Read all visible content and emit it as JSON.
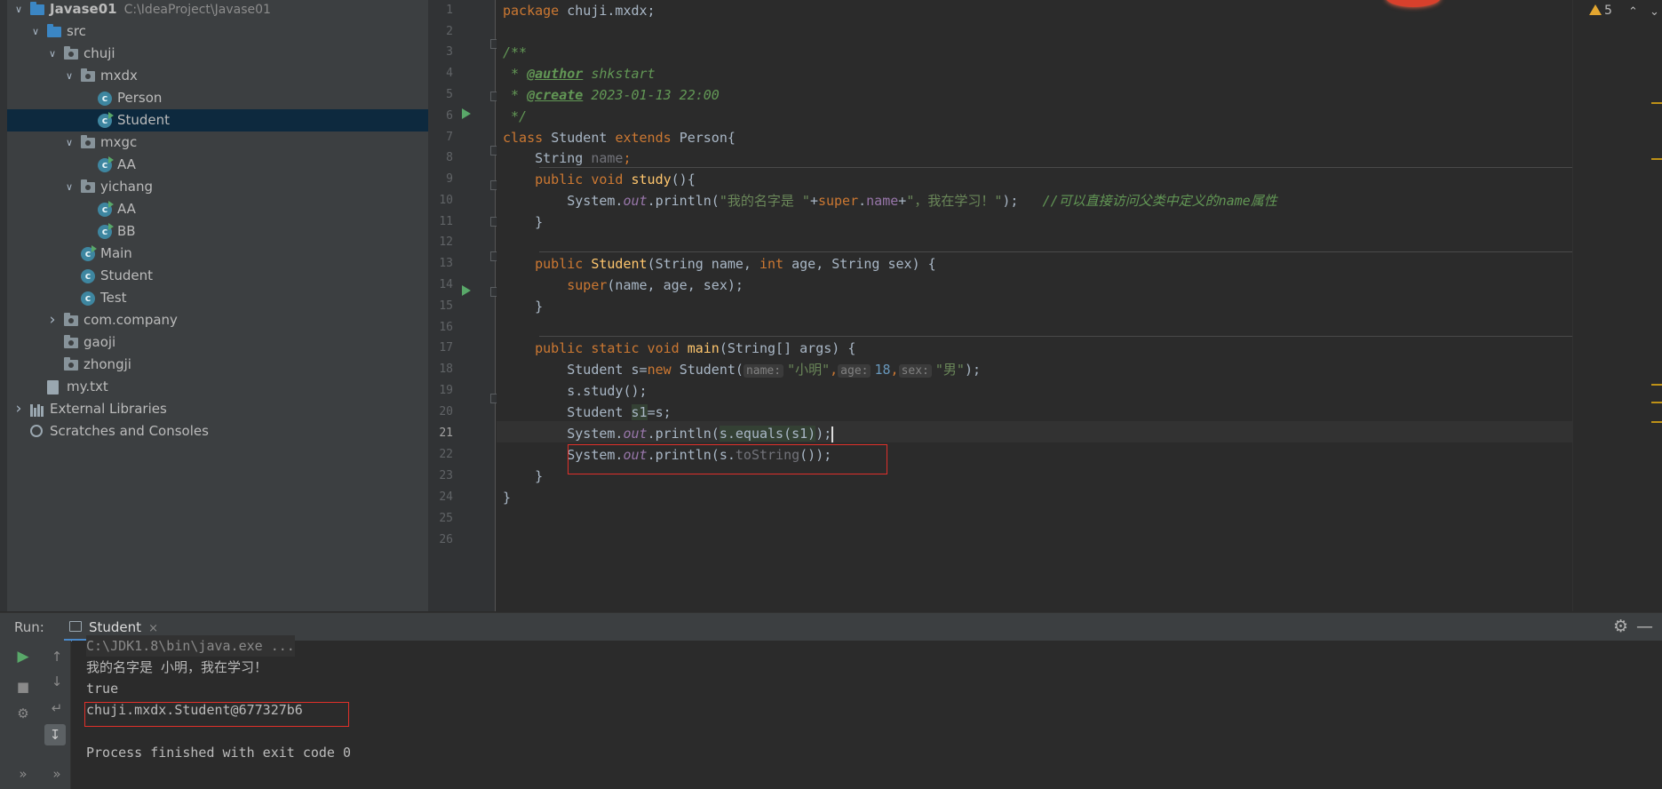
{
  "project_tree": {
    "items": [
      {
        "label": "Javase01",
        "path": "C:\\IdeaProject\\Javase01",
        "icon": "project-folder-icon",
        "indent": 0,
        "chevron": "open"
      },
      {
        "label": "src",
        "icon": "source-folder-icon",
        "indent": 1,
        "chevron": "open"
      },
      {
        "label": "chuji",
        "icon": "package-icon",
        "indent": 2,
        "chevron": "open"
      },
      {
        "label": "mxdx",
        "icon": "package-icon",
        "indent": 3,
        "chevron": "open"
      },
      {
        "label": "Person",
        "icon": "class-icon",
        "indent": 4
      },
      {
        "label": "Student",
        "icon": "class-runnable-icon",
        "indent": 4,
        "selected": true
      },
      {
        "label": "mxgc",
        "icon": "package-icon",
        "indent": 3,
        "chevron": "open"
      },
      {
        "label": "AA",
        "icon": "class-runnable-icon",
        "indent": 4
      },
      {
        "label": "yichang",
        "icon": "package-icon",
        "indent": 3,
        "chevron": "open"
      },
      {
        "label": "AA",
        "icon": "class-runnable-icon",
        "indent": 4
      },
      {
        "label": "BB",
        "icon": "class-runnable-icon",
        "indent": 4
      },
      {
        "label": "Main",
        "icon": "class-runnable-icon",
        "indent": 3
      },
      {
        "label": "Student",
        "icon": "class-icon",
        "indent": 3
      },
      {
        "label": "Test",
        "icon": "class-icon",
        "indent": 3
      },
      {
        "label": "com.company",
        "icon": "package-icon",
        "indent": 2,
        "chevron": "closed"
      },
      {
        "label": "gaoji",
        "icon": "package-icon",
        "indent": 2
      },
      {
        "label": "zhongji",
        "icon": "package-icon",
        "indent": 2
      },
      {
        "label": "my.txt",
        "icon": "text-file-icon",
        "indent": 1
      },
      {
        "label": "External Libraries",
        "icon": "library-icon",
        "indent": 0,
        "chevron": "closed"
      },
      {
        "label": "Scratches and Consoles",
        "icon": "scratches-icon",
        "indent": 0
      }
    ]
  },
  "editor": {
    "line_numbers": [
      "1",
      "2",
      "3",
      "4",
      "5",
      "6",
      "7",
      "8",
      "9",
      "10",
      "11",
      "12",
      "13",
      "14",
      "15",
      "16",
      "17",
      "18",
      "19",
      "20",
      "21",
      "22",
      "23",
      "24",
      "25",
      "26"
    ],
    "current_line": "21",
    "code": {
      "l1_kw": "package ",
      "l1_rest": "chuji.mxdx;",
      "l3": "/**",
      "l4_star": " * ",
      "l4_tag": "@author",
      "l4_text": " shkstart",
      "l5_star": " * ",
      "l5_tag": "@create",
      "l5_text": " 2023-01-13 22:00",
      "l6": " */",
      "l7_kw1": "class ",
      "l7_name": "Student ",
      "l7_kw2": "extends ",
      "l7_rest": "Person{",
      "l8_type": "    String ",
      "l8_field": "name",
      "l8_semi": ";",
      "l9_kw": "    public void ",
      "l9_fn": "study",
      "l9_rest": "(){",
      "l10_a": "        System.",
      "l10_out": "out",
      "l10_b": ".println(",
      "l10_s1": "\"我的名字是 \"",
      "l10_plus1": "+",
      "l10_super": "super",
      "l10_dot": ".",
      "l10_name": "name",
      "l10_plus2": "+",
      "l10_s2": "\"，我在学习！\"",
      "l10_c": ");",
      "l10_comment": "   //可以直接访问父类中定义的name属性",
      "l11": "    }",
      "l13_kw": "    public ",
      "l13_fn": "Student",
      "l13_a": "(String name, ",
      "l13_int": "int ",
      "l13_b": "age, String sex) {",
      "l14_super": "        super",
      "l14_rest": "(name, age, sex);",
      "l15": "    }",
      "l17_kw": "    public static void ",
      "l17_fn": "main",
      "l17_rest": "(String[] args) {",
      "l18_a": "        Student s=",
      "l18_new": "new ",
      "l18_b": "Student(",
      "l18_h1": "name:",
      "l18_s1": "\"小明\"",
      "l18_c1": ",",
      "l18_h2": "age:",
      "l18_n": "18",
      "l18_c2": ",",
      "l18_h3": "sex:",
      "l18_s2": "\"男\"",
      "l18_end": ");",
      "l19": "        s.study();",
      "l20_a": "        Student ",
      "l20_var": "s1",
      "l20_b": "=s;",
      "l21_a": "        System.",
      "l21_out": "out",
      "l21_b": ".println(",
      "l21_mark": "s.equals(s1)",
      "l21_c": ");",
      "l22_a": "        System.",
      "l22_out": "out",
      "l22_b": ".println(s.",
      "l22_fn": "toString",
      "l22_c": "());",
      "l23": "    }",
      "l24": "}"
    }
  },
  "inspections": {
    "warning_count": "5"
  },
  "run_panel": {
    "title": "Run:",
    "tab_label": "Student",
    "close_glyph": "×",
    "output": [
      "C:\\JDK1.8\\bin\\java.exe ...",
      "我的名字是 小明，我在学习！",
      "true",
      "chuji.mxdx.Student@677327b6",
      "",
      "Process finished with exit code 0"
    ]
  },
  "colors": {
    "accent": "#4a88c7",
    "warning": "#e3a630",
    "highlight_box": "#e0302a",
    "run_green": "#59a869"
  }
}
